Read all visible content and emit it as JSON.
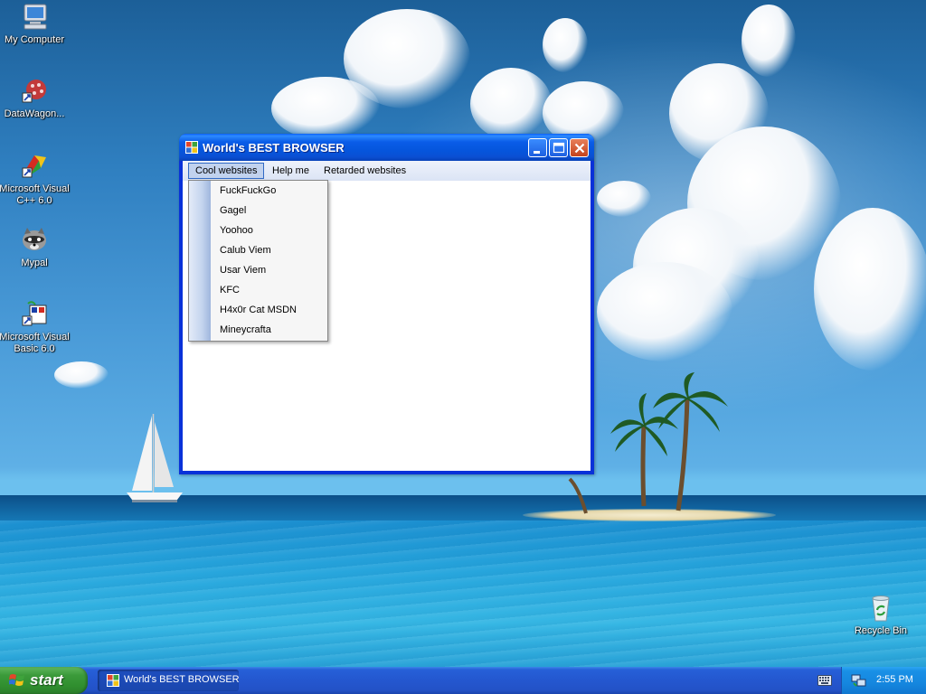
{
  "desktop": {
    "icons": [
      {
        "label": "My Computer"
      },
      {
        "label": "DataWagon..."
      },
      {
        "label": "Microsoft Visual C++ 6.0"
      },
      {
        "label": "Mypal"
      },
      {
        "label": "Microsoft Visual Basic 6.0"
      },
      {
        "label": "Recycle Bin"
      }
    ]
  },
  "window": {
    "title": "World's BEST BROWSER",
    "menu": [
      {
        "label": "Cool websites"
      },
      {
        "label": "Help me"
      },
      {
        "label": "Retarded websites"
      }
    ],
    "dropdown": [
      {
        "label": "FuckFuckGo"
      },
      {
        "label": "Gagel"
      },
      {
        "label": "Yoohoo"
      },
      {
        "label": "Calub Viem"
      },
      {
        "label": "Usar Viem"
      },
      {
        "label": "KFC"
      },
      {
        "label": "H4x0r Cat MSDN"
      },
      {
        "label": "Mineycrafta"
      }
    ]
  },
  "taskbar": {
    "start_label": "start",
    "apps": [
      {
        "label": "World's BEST BROWSER"
      }
    ],
    "clock": "2:55 PM"
  },
  "colors": {
    "title_bar": "#0a5ce8",
    "menu_highlight": "#c1d2ee",
    "taskbar": "#2457cf",
    "start_button": "#3c9b3b",
    "tray": "#1587df"
  },
  "icons": {
    "my_computer": "computer-icon",
    "datawagon": "globe-icon",
    "visual_cpp": "visual-cpp-icon",
    "mypal": "raccoon-icon",
    "visual_basic": "visual-basic-icon",
    "recycle_bin": "recycle-bin-icon",
    "window": "windows-app-icon",
    "keyboard": "keyboard-icon",
    "network": "network-icon"
  }
}
